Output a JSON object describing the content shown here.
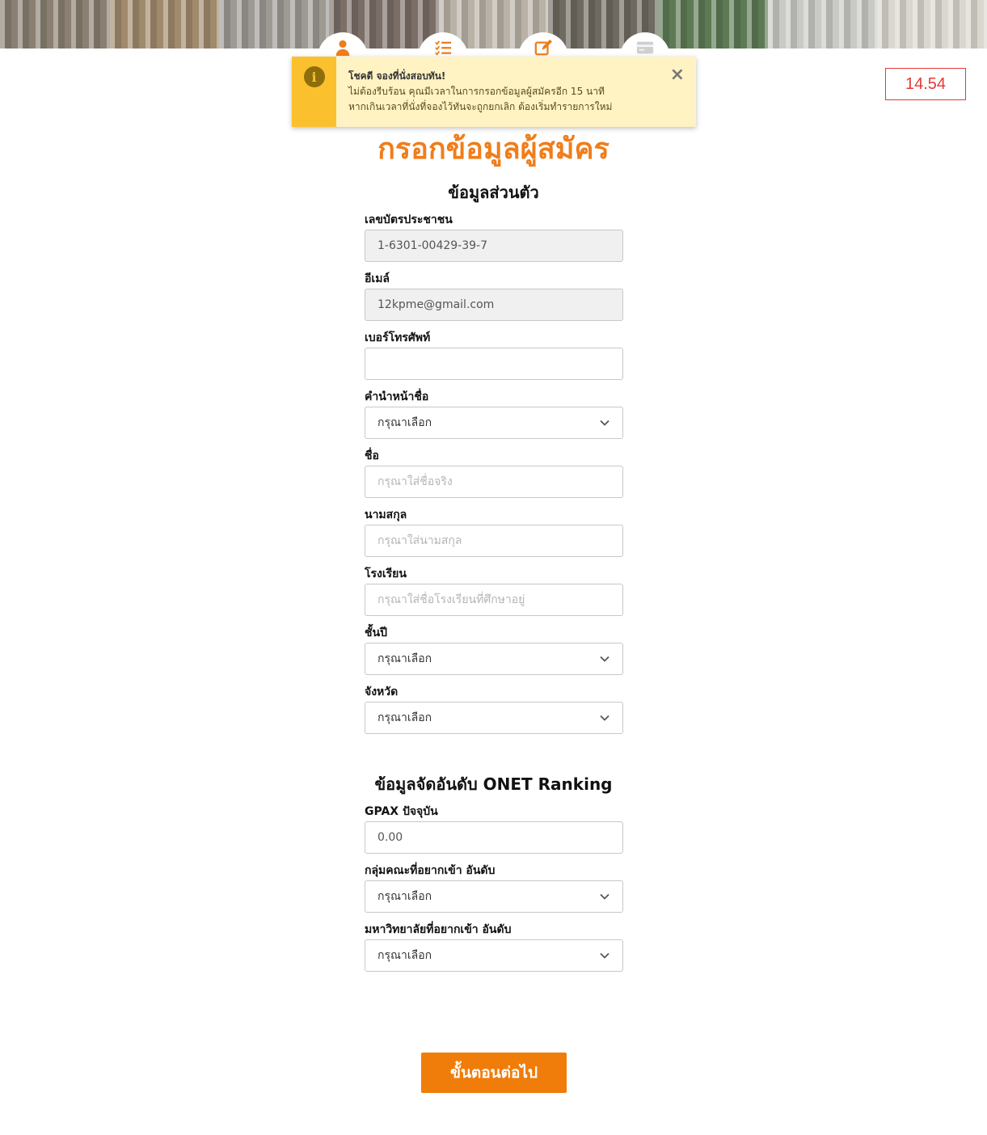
{
  "timer": "14.54",
  "toast": {
    "title": "โชคดี จองที่นั่งสอบทัน!",
    "line1": "ไม่ต้องรีบร้อน คุณมีเวลาในการกรอกข้อมูลผู้สมัครอีก 15 นาที",
    "line2": "หากเกินเวลาที่นั่งที่จองไว้ทันจะถูกยกเลิก ต้องเริ่มทำรายการใหม่",
    "icon": "info-icon",
    "close": "×"
  },
  "steps": [
    "user-icon",
    "checklist-icon",
    "edit-icon",
    "credit-card-icon"
  ],
  "page_title": "กรอกข้อมูลผู้สมัคร",
  "personal": {
    "title": "ข้อมูลส่วนตัว",
    "id_label": "เลขบัตรประชาชน",
    "id_value": "1-6301-00429-39-7",
    "email_label": "อีเมล์",
    "email_value": "12kpme@gmail.com",
    "phone_label": "เบอร์โทรศัพท์",
    "phone_value": "",
    "prefix_label": "คำนำหน้าชื่อ",
    "prefix_value": "กรุณาเลือก",
    "firstname_label": "ชื่อ",
    "firstname_placeholder": "กรุณาใส่ชื่อจริง",
    "lastname_label": "นามสกุล",
    "lastname_placeholder": "กรุณาใส่นามสกุล",
    "school_label": "โรงเรียน",
    "school_placeholder": "กรุณาใส่ชื่อโรงเรียนที่ศึกษาอยู่",
    "grade_label": "ชั้นปี",
    "grade_value": "กรุณาเลือก",
    "province_label": "จังหวัด",
    "province_value": "กรุณาเลือก"
  },
  "ranking": {
    "title": "ข้อมูลจัดอันดับ ONET Ranking",
    "gpax_label": "GPAX ปัจจุบัน",
    "gpax_value": "0.00",
    "faculty_label": "กลุ่มคณะที่อยากเข้า อันดับ",
    "faculty_value": "กรุณาเลือก",
    "university_label": "มหาวิทยาลัยที่อยากเข้า อันดับ",
    "university_value": "กรุณาเลือก"
  },
  "next_button": "ขั้นตอนต่อไป",
  "colors": {
    "accent": "#f07d1a",
    "timer": "#e53935",
    "toast_bg": "#fff3c4",
    "toast_bar": "#fbc02d"
  }
}
